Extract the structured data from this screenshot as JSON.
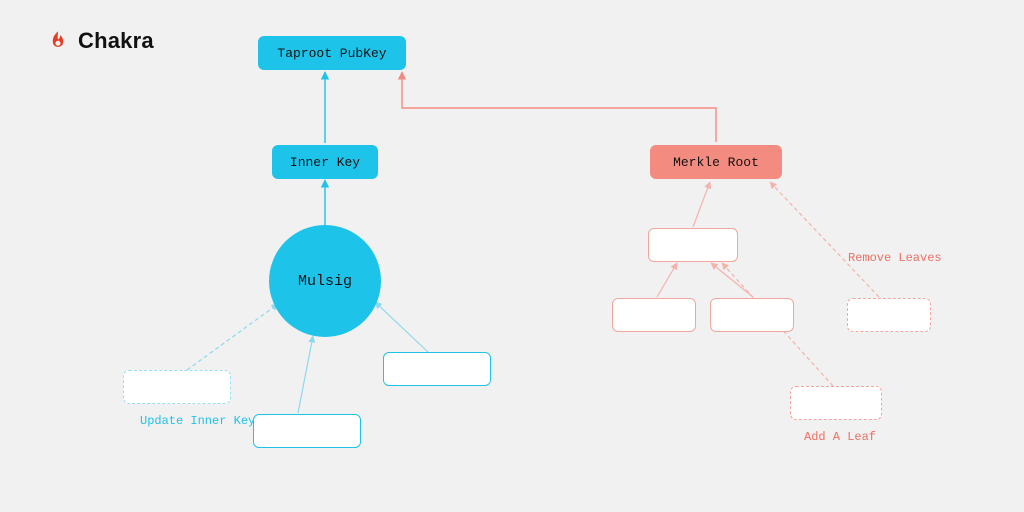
{
  "brand": {
    "name": "Chakra"
  },
  "colors": {
    "cyan": "#1ec3ea",
    "cyan_soft": "#8bd9ed",
    "red": "#f48b81",
    "red_soft": "#f4b2ab",
    "bg": "#f1f1f1"
  },
  "nodes": {
    "taproot": {
      "label": "Taproot PubKey"
    },
    "inner_key": {
      "label": "Inner Key"
    },
    "mulsig": {
      "label": "Mulsig"
    },
    "merkle_root": {
      "label": "Merkle Root"
    }
  },
  "captions": {
    "update_inner_key": "Update Inner Key",
    "remove_leaves": "Remove Leaves",
    "add_a_leaf": "Add A Leaf"
  }
}
